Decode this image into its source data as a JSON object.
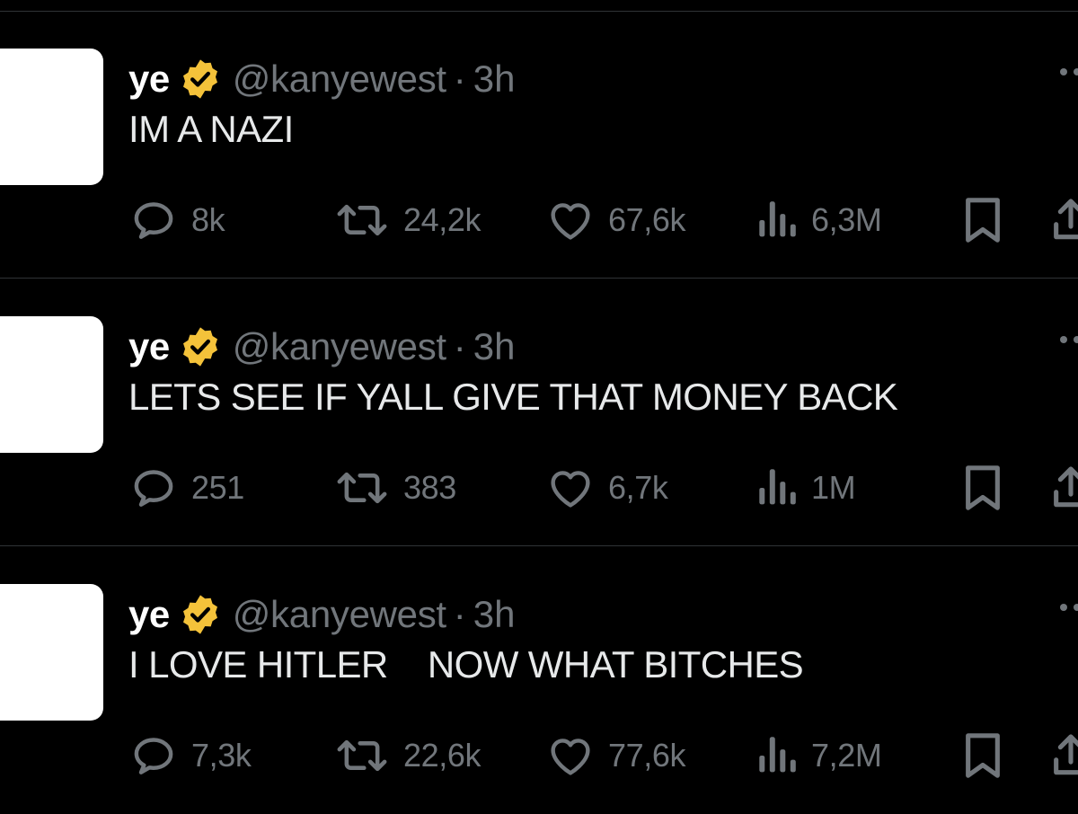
{
  "tweets": [
    {
      "name": "ye",
      "handle": "@kanyewest",
      "separator": "·",
      "time": "3h",
      "text": "IM A NAZI",
      "replies": "8k",
      "reposts": "24,2k",
      "likes": "67,6k",
      "views": "6,3M"
    },
    {
      "name": "ye",
      "handle": "@kanyewest",
      "separator": "·",
      "time": "3h",
      "text": "LETS SEE IF YALL GIVE THAT MONEY BACK",
      "replies": "251",
      "reposts": "383",
      "likes": "6,7k",
      "views": "1M"
    },
    {
      "name": "ye",
      "handle": "@kanyewest",
      "separator": "·",
      "time": "3h",
      "text": "I LOVE HITLER    NOW WHAT BITCHES",
      "replies": "7,3k",
      "reposts": "22,6k",
      "likes": "77,6k",
      "views": "7,2M"
    }
  ],
  "icons": {
    "verified": "verified-badge-icon",
    "reply": "reply-icon",
    "repost": "repost-icon",
    "like": "heart-icon",
    "views": "views-icon",
    "bookmark": "bookmark-icon",
    "share": "share-icon",
    "more": "more-icon"
  },
  "colors": {
    "background": "#000000",
    "text": "#e7e9ea",
    "muted": "#71767b",
    "badge": "#f4c23a",
    "divider": "#2f3336"
  }
}
